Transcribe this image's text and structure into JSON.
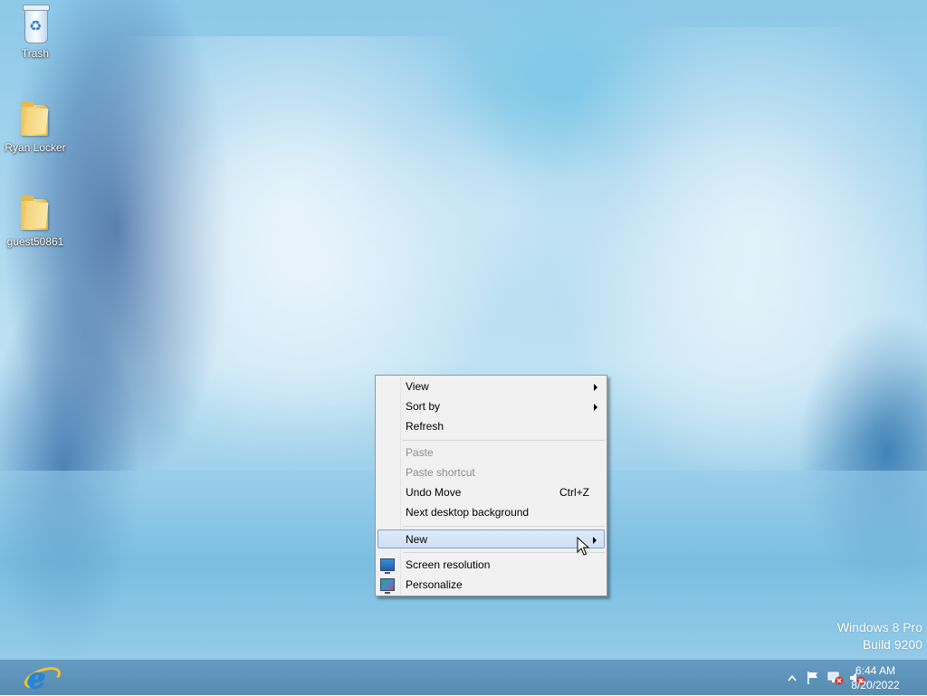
{
  "desktop": {
    "icons": [
      {
        "label": "Trash",
        "icon": "recycle-bin-icon"
      },
      {
        "label": "Ryan Locker",
        "icon": "folder-icon"
      },
      {
        "label": "guest50861",
        "icon": "folder-icon"
      }
    ],
    "watermark": {
      "line1": "Windows 8 Pro",
      "line2": "Build 9200"
    }
  },
  "context_menu": {
    "items": [
      {
        "label": "View",
        "submenu": true
      },
      {
        "label": "Sort by",
        "submenu": true
      },
      {
        "label": "Refresh"
      },
      {
        "label": "Paste",
        "disabled": true
      },
      {
        "label": "Paste shortcut",
        "disabled": true
      },
      {
        "label": "Undo Move",
        "shortcut": "Ctrl+Z"
      },
      {
        "label": "Next desktop background"
      },
      {
        "label": "New",
        "submenu": true,
        "highlighted": true
      },
      {
        "label": "Screen resolution",
        "icon": "screen-resolution-icon"
      },
      {
        "label": "Personalize",
        "icon": "personalize-icon"
      }
    ]
  },
  "taskbar": {
    "pinned": [
      {
        "icon": "internet-explorer-icon"
      }
    ],
    "tray": {
      "icons": [
        "show-hidden-icons-chevron-icon",
        "action-center-flag-icon",
        "network-disconnected-icon",
        "volume-muted-icon"
      ],
      "time": "6:44 AM",
      "date": "8/20/2022"
    }
  },
  "colors": {
    "taskbar": "#5f96be",
    "menu_bg": "#f1f1f1",
    "menu_highlight": "#cfe0f5",
    "menu_highlight_border": "#7da2ce",
    "disabled_text": "#8d8d8d"
  }
}
